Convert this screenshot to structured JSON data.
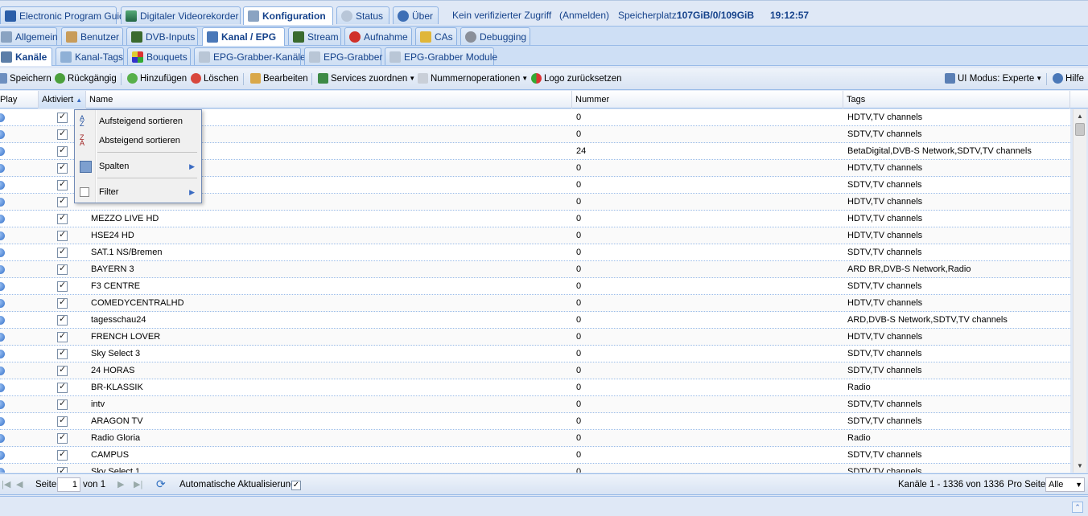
{
  "top_tabs": [
    {
      "label": "Electronic Program Guide",
      "icon": "epg-icon"
    },
    {
      "label": "Digitaler Videorekorder",
      "icon": "download-icon"
    },
    {
      "label": "Konfiguration",
      "icon": "wrench-icon",
      "active": true
    },
    {
      "label": "Status",
      "icon": "eye-icon"
    },
    {
      "label": "Über",
      "icon": "info-icon"
    }
  ],
  "status_bar": {
    "access": "Kein verifizierter Zugriff",
    "login": "(Anmelden)",
    "storage_label": "Speicherplatz:",
    "storage_value": "107GiB/0/109GiB",
    "time": "19:12:57"
  },
  "config_tabs": [
    {
      "label": "Allgemein",
      "icon": "wrench-icon"
    },
    {
      "label": "Benutzer",
      "icon": "users-icon"
    },
    {
      "label": "DVB-Inputs",
      "icon": "film-icon"
    },
    {
      "label": "Kanal / EPG",
      "icon": "tv-icon",
      "active": true
    },
    {
      "label": "Stream",
      "icon": "film-icon"
    },
    {
      "label": "Aufnahme",
      "icon": "rec-icon"
    },
    {
      "label": "CAs",
      "icon": "key-icon"
    },
    {
      "label": "Debugging",
      "icon": "gear-icon"
    }
  ],
  "sub_tabs": [
    {
      "label": "Kanäle",
      "icon": "channel-icon",
      "active": true
    },
    {
      "label": "Kanal-Tags",
      "icon": "tags-icon"
    },
    {
      "label": "Bouquets",
      "icon": "grid-icon"
    },
    {
      "label": "EPG-Grabber-Kanäle",
      "icon": "wrench-icon"
    },
    {
      "label": "EPG-Grabber",
      "icon": "wrench-icon"
    },
    {
      "label": "EPG-Grabber Module",
      "icon": "wrench-icon"
    }
  ],
  "toolbar": {
    "save": "Speichern",
    "undo": "Rückgängig",
    "add": "Hinzufügen",
    "delete": "Löschen",
    "edit": "Bearbeiten",
    "assign_services": "Services zuordnen",
    "number_ops": "Nummernoperationen",
    "reset_logo": "Logo zurücksetzen",
    "ui_mode": "UI Modus: Experte",
    "help": "Hilfe"
  },
  "columns": {
    "play": "Play",
    "enabled": "Aktiviert",
    "name": "Name",
    "number": "Nummer",
    "tags": "Tags"
  },
  "rows": [
    {
      "name": "",
      "number": "0",
      "tags": "HDTV,TV channels"
    },
    {
      "name": "",
      "number": "0",
      "tags": "SDTV,TV channels"
    },
    {
      "name": "",
      "number": "24",
      "tags": "BetaDigital,DVB-S Network,SDTV,TV channels"
    },
    {
      "name": "",
      "number": "0",
      "tags": "HDTV,TV channels"
    },
    {
      "name": "",
      "number": "0",
      "tags": "SDTV,TV channels"
    },
    {
      "name": "",
      "number": "0",
      "tags": "HDTV,TV channels"
    },
    {
      "name": "MEZZO LIVE HD",
      "number": "0",
      "tags": "HDTV,TV channels"
    },
    {
      "name": "HSE24 HD",
      "number": "0",
      "tags": "HDTV,TV channels"
    },
    {
      "name": "SAT.1 NS/Bremen",
      "number": "0",
      "tags": "SDTV,TV channels"
    },
    {
      "name": "BAYERN 3",
      "number": "0",
      "tags": "ARD BR,DVB-S Network,Radio"
    },
    {
      "name": "F3 CENTRE",
      "number": "0",
      "tags": "SDTV,TV channels"
    },
    {
      "name": "COMEDYCENTRALHD",
      "number": "0",
      "tags": "HDTV,TV channels"
    },
    {
      "name": "tagesschau24",
      "number": "0",
      "tags": "ARD,DVB-S Network,SDTV,TV channels"
    },
    {
      "name": "FRENCH LOVER",
      "number": "0",
      "tags": "HDTV,TV channels"
    },
    {
      "name": "Sky Select 3",
      "number": "0",
      "tags": "SDTV,TV channels"
    },
    {
      "name": "24 HORAS",
      "number": "0",
      "tags": "SDTV,TV channels"
    },
    {
      "name": "BR-KLASSIK",
      "number": "0",
      "tags": "Radio"
    },
    {
      "name": "intv",
      "number": "0",
      "tags": "SDTV,TV channels"
    },
    {
      "name": "ARAGON TV",
      "number": "0",
      "tags": "SDTV,TV channels"
    },
    {
      "name": "Radio Gloria",
      "number": "0",
      "tags": "Radio"
    },
    {
      "name": "CAMPUS",
      "number": "0",
      "tags": "SDTV,TV channels"
    },
    {
      "name": "Sky Select 1",
      "number": "0",
      "tags": "SDTV,TV channels"
    }
  ],
  "column_menu": {
    "sort_asc": "Aufsteigend sortieren",
    "sort_desc": "Absteigend sortieren",
    "columns": "Spalten",
    "filter": "Filter"
  },
  "pager": {
    "page_label": "Seite",
    "page_value": "1",
    "of_label": "von 1",
    "auto_refresh": "Automatische Aktualisierung",
    "summary": "Kanäle 1 - 1336 von 1336",
    "per_page_label": "Pro Seite",
    "per_page_value": "Alle"
  },
  "colors": {
    "accent": "#15428b",
    "header_bg": "#dfe8f6",
    "border": "#99bbe8"
  }
}
